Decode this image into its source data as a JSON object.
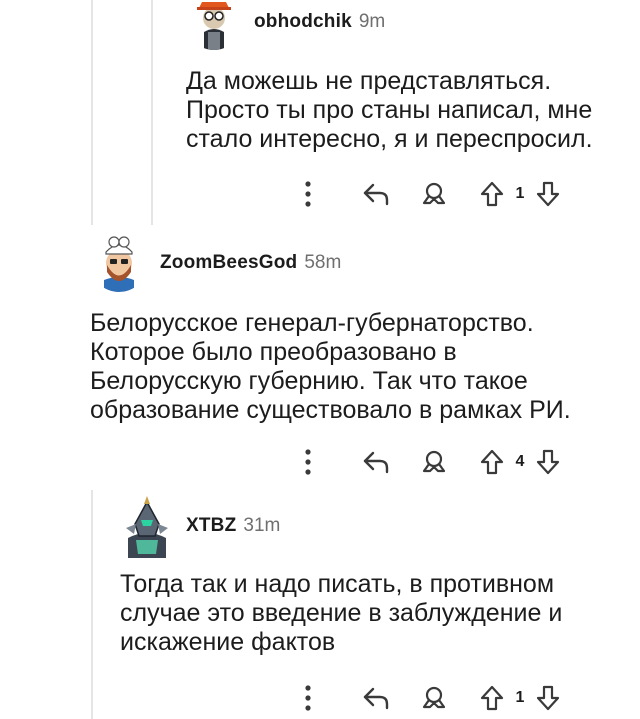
{
  "comments": [
    {
      "username": "obhodchik",
      "time": "9m",
      "lines": [
        "Да можешь не представляться.",
        "Просто ты про станы написал, мне",
        "стало интересно, я и переспросил."
      ],
      "score": "1",
      "avatar": "avatar-orange-hat-goggles"
    },
    {
      "username": "ZoomBeesGod",
      "time": "58m",
      "lines": [
        "Белорусское генерал-губернаторство.",
        "Которое было преобразовано в",
        "Белорусскую губернию. Так что такое",
        "образование существовало в рамках РИ."
      ],
      "score": "4",
      "avatar": "avatar-bearded-chef"
    },
    {
      "username": "XTBZ",
      "time": "31m",
      "lines": [
        "Тогда так и надо писать, в противном",
        "случае это введение в заблуждение и",
        "искажение фактов"
      ],
      "score": "1",
      "avatar": "avatar-armored-knight"
    }
  ],
  "icons": [
    "more-icon",
    "reply-icon",
    "award-icon",
    "upvote-icon",
    "downvote-icon"
  ],
  "colors": {
    "text": "#1c1c1c",
    "muted": "#6f6f6f",
    "thread": "#e5e5e5",
    "icon": "#4a4a4a"
  }
}
